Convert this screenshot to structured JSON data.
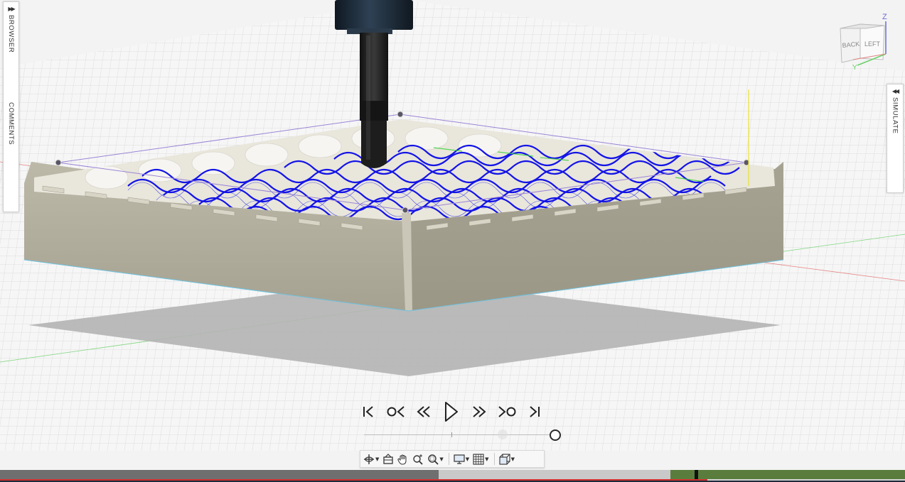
{
  "window": {
    "left_panel": {
      "browser_label": "BROWSER",
      "comments_label": "COMMENTS",
      "expand_arrow": "▶▶"
    },
    "right_panel": {
      "simulate_label": "SIMULATE",
      "collapse_arrow": "◀◀"
    }
  },
  "view_cube": {
    "back_label": "BACK",
    "left_label": "LEFT",
    "z_label": "Z",
    "y_label": "Y"
  },
  "playback": {
    "buttons": [
      {
        "name": "go-to-start",
        "icon": "skip-start-icon"
      },
      {
        "name": "previous-event",
        "icon": "prev-event-icon"
      },
      {
        "name": "step-backward",
        "icon": "step-back-icon"
      },
      {
        "name": "play",
        "icon": "play-icon"
      },
      {
        "name": "step-forward",
        "icon": "step-forward-icon"
      },
      {
        "name": "next-event",
        "icon": "next-event-icon"
      },
      {
        "name": "go-to-end",
        "icon": "skip-end-icon"
      }
    ],
    "progress": 1.0
  },
  "toolbar": {
    "items": [
      {
        "name": "orbit",
        "icon": "orbit-icon",
        "has_menu": true
      },
      {
        "name": "look-at",
        "icon": "look-at-icon",
        "has_menu": false
      },
      {
        "name": "pan",
        "icon": "hand-icon",
        "has_menu": false
      },
      {
        "name": "zoom",
        "icon": "zoom-icon",
        "has_menu": false
      },
      {
        "name": "fit",
        "icon": "zoom-window-icon",
        "has_menu": true
      },
      {
        "name": "display-settings",
        "icon": "monitor-icon",
        "has_menu": true
      },
      {
        "name": "grid-settings",
        "icon": "grid-icon",
        "has_menu": true
      },
      {
        "name": "viewports",
        "icon": "cube-view-icon",
        "has_menu": true
      }
    ]
  },
  "colors": {
    "toolpath_blue": "#1212e8",
    "stock_tan": "#b7b2a2",
    "tool_holder": "#1d2a3a",
    "tool_shank": "#232323",
    "status_green": "#5a7d3e",
    "axis_red": "#e05a5a",
    "axis_green": "#6ad06a",
    "axis_yellow": "#e8e232"
  }
}
